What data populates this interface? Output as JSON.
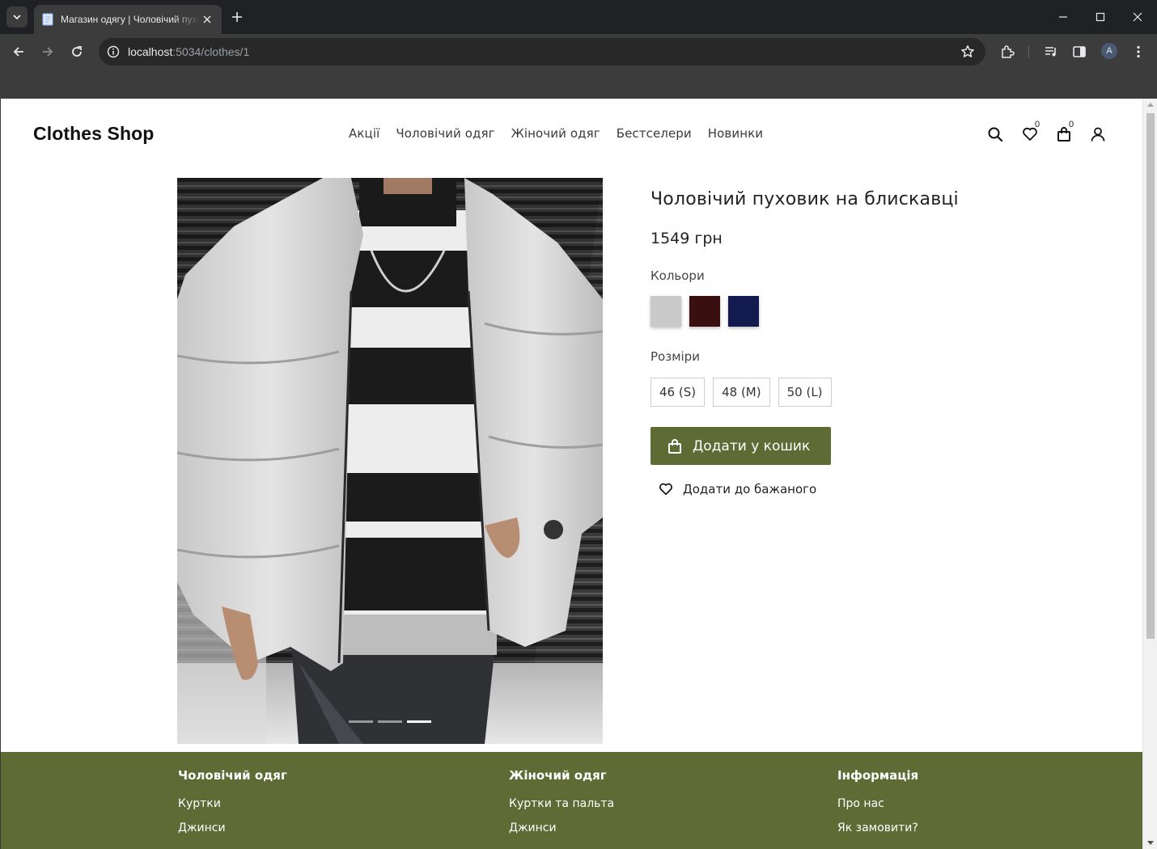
{
  "browser": {
    "tab_title": "Магазин одягу | Чоловічий пуховик на блискавці",
    "url_host": "localhost",
    "url_path": ":5034/clothes/1",
    "profile_initial": "A"
  },
  "site": {
    "logo": "Clothes Shop",
    "nav": [
      "Акції",
      "Чоловічий одяг",
      "Жіночий одяг",
      "Бестселери",
      "Новинки"
    ],
    "wishlist_count": "0",
    "cart_count": "0"
  },
  "product": {
    "title": "Чоловічий пуховик на блискавці",
    "price": "1549 грн",
    "colors_label": "Кольори",
    "colors": [
      "#c9c9c9",
      "#3a0f0f",
      "#121a4f"
    ],
    "sizes_label": "Розміри",
    "sizes": [
      "46 (S)",
      "48 (M)",
      "50 (L)"
    ],
    "add_to_cart": "Додати у кошик",
    "add_to_wishlist": "Додати до бажаного",
    "carousel_active_index": 2
  },
  "footer": {
    "columns": [
      {
        "heading": "Чоловічий одяг",
        "links": [
          "Куртки",
          "Джинси"
        ]
      },
      {
        "heading": "Жіночий одяг",
        "links": [
          "Куртки та пальта",
          "Джинси"
        ]
      },
      {
        "heading": "Інформація",
        "links": [
          "Про нас",
          "Як замовити?"
        ]
      }
    ]
  },
  "theme": {
    "accent": "#5e6b34"
  }
}
